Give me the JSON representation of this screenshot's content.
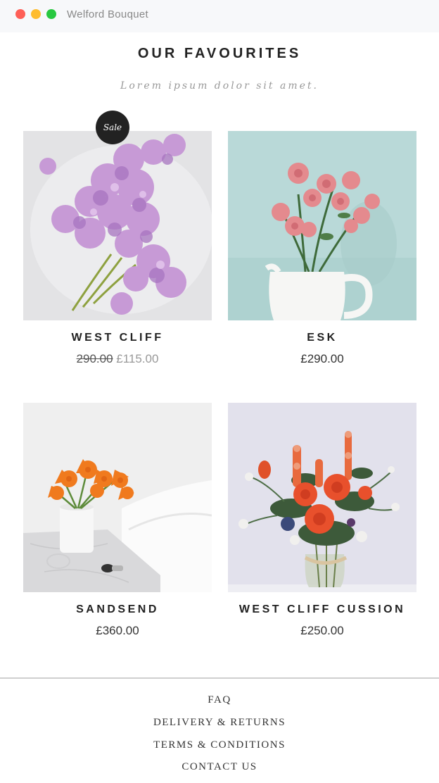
{
  "window": {
    "title": "Welford Bouquet"
  },
  "section": {
    "title": "OUR FAVOURITES",
    "subtitle": "Lorem ipsum dolor sit amet."
  },
  "products": [
    {
      "name": "WEST CLIFF",
      "old_price": "290.00",
      "price": "£115.00",
      "badge": "Sale",
      "image": "lilac-flowers"
    },
    {
      "name": "ESK",
      "price": "£290.00",
      "image": "pink-roses-in-white-jug"
    },
    {
      "name": "SANDSEND",
      "price": "£360.00",
      "image": "orange-lilies-in-vase"
    },
    {
      "name": "WEST CLIFF CUSSION",
      "price": "£250.00",
      "image": "mixed-bouquet-in-jar"
    }
  ],
  "footer": {
    "links": [
      "FAQ",
      "DELIVERY & RETURNS",
      "TERMS & CONDITIONS",
      "CONTACT US"
    ]
  },
  "colors": {
    "badge_bg": "#222222",
    "sale_price": "#999999",
    "titlebar_bg": "#f7f8fa"
  }
}
